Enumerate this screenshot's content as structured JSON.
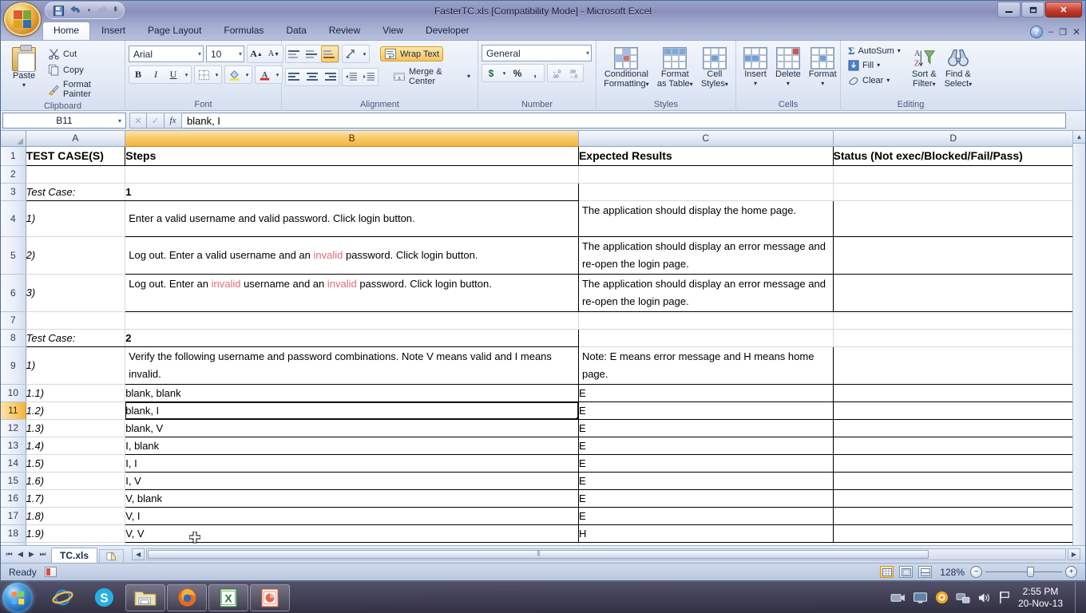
{
  "window": {
    "title": "FasterTC.xls [Compatibility Mode] - Microsoft Excel",
    "minimize_label": "–",
    "restore_label": "❐",
    "close_label": "✕"
  },
  "quick_access": {
    "save_label": "💾",
    "undo_label": "↶",
    "redo_label": "↷",
    "customize_label": "▾"
  },
  "doc_controls": {
    "help_label": "?",
    "minimize_label": "–",
    "restore_label": "❐",
    "close_label": "✕"
  },
  "tabs": [
    {
      "label": "Home",
      "active": true
    },
    {
      "label": "Insert",
      "active": false
    },
    {
      "label": "Page Layout",
      "active": false
    },
    {
      "label": "Formulas",
      "active": false
    },
    {
      "label": "Data",
      "active": false
    },
    {
      "label": "Review",
      "active": false
    },
    {
      "label": "View",
      "active": false
    },
    {
      "label": "Developer",
      "active": false
    }
  ],
  "ribbon": {
    "clipboard": {
      "group_label": "Clipboard",
      "paste_label": "Paste",
      "paste_arrow": "▾",
      "cut_label": "Cut",
      "copy_label": "Copy",
      "format_painter_label": "Format Painter"
    },
    "font": {
      "group_label": "Font",
      "font_name": "Arial",
      "font_size": "10",
      "grow_label": "A",
      "shrink_label": "A",
      "bold_label": "B",
      "italic_label": "I",
      "underline_label": "U",
      "underline_arrow": "▾",
      "borders_arrow": "▾",
      "fill_label": "△",
      "fill_arrow": "▾",
      "fontcolor_label": "A",
      "fontcolor_arrow": "▾",
      "combo_arrow": "▾"
    },
    "alignment": {
      "group_label": "Alignment",
      "wrap_text_label": "Wrap Text",
      "merge_center_label": "Merge & Center",
      "merge_arrow": "▾",
      "orientation_arrow": "▾"
    },
    "number": {
      "group_label": "Number",
      "format_value": "General",
      "combo_arrow": "▾",
      "currency_label": "$",
      "currency_arrow": "▾",
      "percent_label": "%",
      "comma_label": ",",
      "inc_decimal_label": "←.0",
      "dec_decimal_label": ".00"
    },
    "styles": {
      "group_label": "Styles",
      "conditional_label_1": "Conditional",
      "conditional_label_2": "Formatting",
      "format_table_label_1": "Format",
      "format_table_label_2": "as Table",
      "cell_styles_label_1": "Cell",
      "cell_styles_label_2": "Styles",
      "arrow": "▾"
    },
    "cells": {
      "group_label": "Cells",
      "insert_label": "Insert",
      "delete_label": "Delete",
      "format_label": "Format",
      "arrow": "▾"
    },
    "editing": {
      "group_label": "Editing",
      "autosum_label": "AutoSum",
      "fill_label": "Fill",
      "clear_label": "Clear",
      "sort_filter_label_1": "Sort &",
      "sort_filter_label_2": "Filter",
      "find_select_label_1": "Find &",
      "find_select_label_2": "Select",
      "arrow": "▾",
      "sigma": "Σ"
    },
    "dialog_launcher_label": "⤵"
  },
  "formula_bar": {
    "name_box_value": "B11",
    "name_box_arrow": "▾",
    "cancel_label": "✕",
    "enter_label": "✓",
    "fx_label": "fx",
    "formula_value": "blank, I"
  },
  "grid": {
    "columns": [
      {
        "label": "A",
        "selected": false
      },
      {
        "label": "B",
        "selected": true
      },
      {
        "label": "C",
        "selected": false
      },
      {
        "label": "D",
        "selected": false
      }
    ],
    "selected_cell": "B11",
    "rows": [
      {
        "num": "1",
        "a": "TEST CASE(S)",
        "b": "Steps",
        "c": "Expected Results",
        "d": "Status (Not exec/Blocked/Fail/Pass)"
      },
      {
        "num": "2",
        "a": "",
        "b": "",
        "c": "",
        "d": ""
      },
      {
        "num": "3",
        "a": "Test Case:",
        "b": "1",
        "c": "",
        "d": ""
      },
      {
        "num": "4",
        "a": "1)",
        "b": "Enter a valid username and valid password. Click login button.",
        "c": "The application should display the home page.",
        "d": ""
      },
      {
        "num": "5",
        "a": "2)",
        "b": "Log out. Enter a valid username and an invalid password. Click login button.",
        "c": "The application should display an error message and re-open the login page.",
        "d": ""
      },
      {
        "num": "6",
        "a": "3)",
        "b": "Log out. Enter an invalid username and an invalid password. Click login button.",
        "c": "The application should display an error message and re-open the login page.",
        "d": ""
      },
      {
        "num": "7",
        "a": "",
        "b": "",
        "c": "",
        "d": ""
      },
      {
        "num": "8",
        "a": "Test Case:",
        "b": "2",
        "c": "",
        "d": ""
      },
      {
        "num": "9",
        "a": "1)",
        "b": "Verify the following username and password combinations. Note V means valid and I means invalid.",
        "c": "Note: E means error message and H means home page.",
        "d": ""
      },
      {
        "num": "10",
        "a": "1.1)",
        "b": "blank, blank",
        "c": "E",
        "d": ""
      },
      {
        "num": "11",
        "a": "1.2)",
        "b": "blank, I",
        "c": "E",
        "d": ""
      },
      {
        "num": "12",
        "a": "1.3)",
        "b": "blank, V",
        "c": "E",
        "d": ""
      },
      {
        "num": "13",
        "a": "1.4)",
        "b": "I, blank",
        "c": "E",
        "d": ""
      },
      {
        "num": "14",
        "a": "1.5)",
        "b": "I, I",
        "c": "E",
        "d": ""
      },
      {
        "num": "15",
        "a": "1.6)",
        "b": "I, V",
        "c": "E",
        "d": ""
      },
      {
        "num": "16",
        "a": "1.7)",
        "b": "V, blank",
        "c": "E",
        "d": ""
      },
      {
        "num": "17",
        "a": "1.8)",
        "b": "V, I",
        "c": "E",
        "d": ""
      },
      {
        "num": "18",
        "a": "1.9)",
        "b": "V, V",
        "c": "H",
        "d": ""
      },
      {
        "num": "19",
        "a": "",
        "b": "",
        "c": "",
        "d": ""
      }
    ],
    "highlight_word": "invalid",
    "highlight_color": "#e06c78"
  },
  "sheet_tabs": {
    "first_label": "⏮",
    "prev_label": "◀",
    "next_label": "▶",
    "last_label": "⏭",
    "tabs": [
      {
        "label": "TC.xls",
        "active": true
      }
    ],
    "new_sheet_label": "➕",
    "scroll_left_label": "◀",
    "scroll_right_label": "▶",
    "vscroll_up_label": "▲",
    "vscroll_down_label": "▼"
  },
  "status_bar": {
    "status_text": "Ready",
    "macro_icon": "record-macro-icon",
    "view_normal": "▦",
    "view_layout": "▣",
    "view_break": "▤",
    "zoom_value": "128%",
    "zoom_out_label": "−",
    "zoom_in_label": "+"
  },
  "taskbar": {
    "start_label": "start-orb",
    "items": [
      {
        "name": "internet-explorer",
        "boxed": false
      },
      {
        "name": "skype",
        "boxed": false
      },
      {
        "name": "windows-explorer",
        "boxed": true
      },
      {
        "name": "firefox",
        "boxed": true
      },
      {
        "name": "microsoft-excel",
        "boxed": true
      },
      {
        "name": "microsoft-powerpoint",
        "boxed": true
      }
    ],
    "tray": [
      {
        "name": "projector-icon"
      },
      {
        "name": "display-icon"
      },
      {
        "name": "update-icon"
      },
      {
        "name": "network-icon"
      },
      {
        "name": "volume-icon"
      },
      {
        "name": "action-center-flag-icon"
      }
    ],
    "time": "2:55 PM",
    "date": "20-Nov-13"
  }
}
